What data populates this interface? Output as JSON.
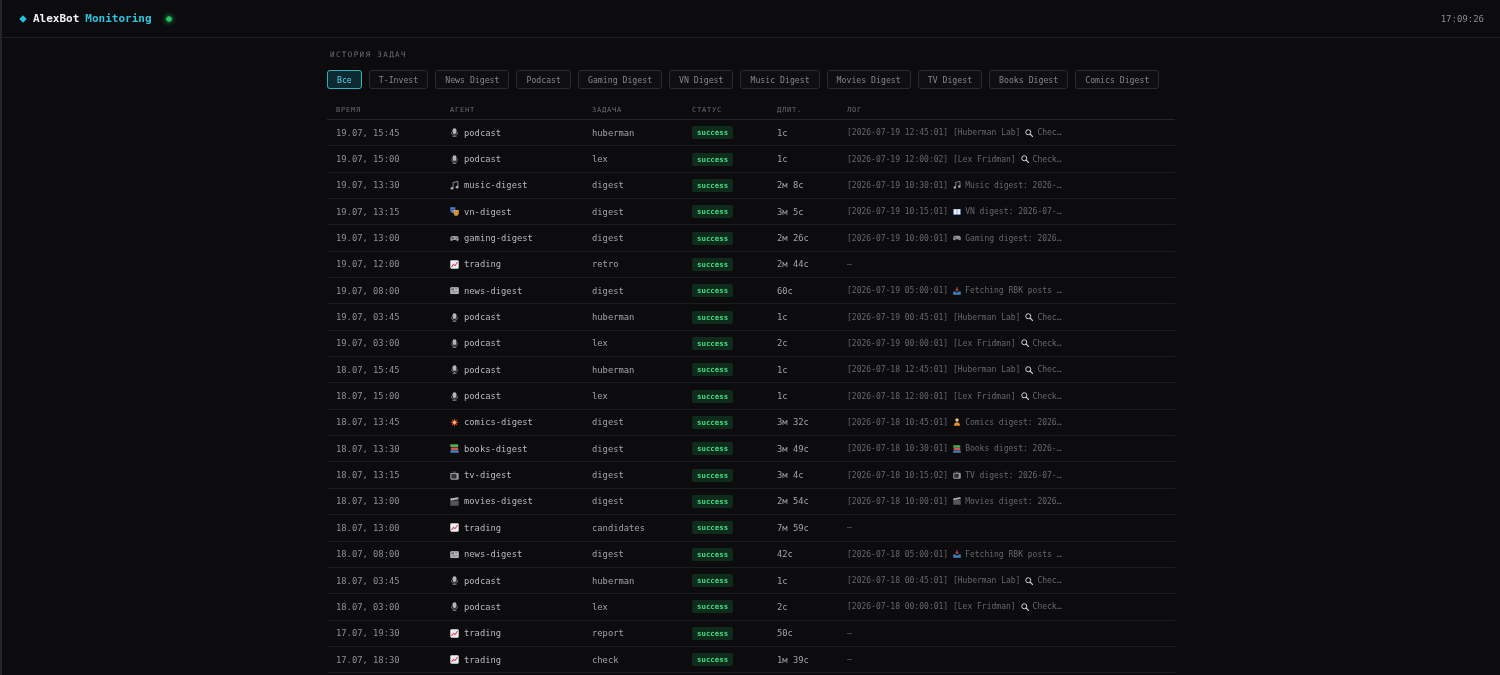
{
  "header": {
    "brand": "AlexBot",
    "brand_suffix": "Monitoring",
    "online": true,
    "clock": "17:09:26"
  },
  "history": {
    "title": "ИСТОРИЯ ЗАДАЧ",
    "filters": [
      {
        "label": "Все",
        "selected": true
      },
      {
        "label": "T-Invest",
        "selected": false
      },
      {
        "label": "News Digest",
        "selected": false
      },
      {
        "label": "Podcast",
        "selected": false
      },
      {
        "label": "Gaming Digest",
        "selected": false
      },
      {
        "label": "VN Digest",
        "selected": false
      },
      {
        "label": "Music Digest",
        "selected": false
      },
      {
        "label": "Movies Digest",
        "selected": false
      },
      {
        "label": "TV Digest",
        "selected": false
      },
      {
        "label": "Books Digest",
        "selected": false
      },
      {
        "label": "Comics Digest",
        "selected": false
      }
    ],
    "table": {
      "columns": [
        "ВРЕМЯ",
        "АГЕНТ",
        "ЗАДАЧА",
        "СТАТУС",
        "ДЛИТ.",
        "ЛОГ"
      ],
      "rows": [
        {
          "time": "19.07, 15:45",
          "agent": "podcast",
          "kind": "podcast",
          "task": "huberman",
          "status": "success",
          "duration": "1с",
          "log": {
            "head": "[2026-07-19 12:45:01] [Huberman Lab]",
            "tail": "Chec…"
          }
        },
        {
          "time": "19.07, 15:00",
          "agent": "podcast",
          "kind": "podcast",
          "task": "lex",
          "status": "success",
          "duration": "1с",
          "log": {
            "head": "[2026-07-19 12:00:02] [Lex Fridman]",
            "tail": "Check…"
          }
        },
        {
          "time": "19.07, 13:30",
          "agent": "music-digest",
          "kind": "music",
          "task": "digest",
          "status": "success",
          "duration": "2м 8с",
          "log": {
            "head": "[2026-07-19 10:30:01]",
            "tail": "Music digest: 2026-…"
          }
        },
        {
          "time": "19.07, 13:15",
          "agent": "vn-digest",
          "kind": "vn",
          "task": "digest",
          "status": "success",
          "duration": "3м 5с",
          "log": {
            "head": "[2026-07-19 10:15:01]",
            "tail": "VN digest: 2026-07-…"
          }
        },
        {
          "time": "19.07, 13:00",
          "agent": "gaming-digest",
          "kind": "gaming",
          "task": "digest",
          "status": "success",
          "duration": "2м 26с",
          "log": {
            "head": "[2026-07-19 10:00:01]",
            "tail": "Gaming digest: 2026…"
          }
        },
        {
          "time": "19.07, 12:00",
          "agent": "trading",
          "kind": "trading",
          "task": "retro",
          "status": "success",
          "duration": "2м 44с",
          "log": {
            "head": "—"
          }
        },
        {
          "time": "19.07, 08:00",
          "agent": "news-digest",
          "kind": "news",
          "task": "digest",
          "status": "success",
          "duration": "60с",
          "log": {
            "head": "[2026-07-19 05:00:01]",
            "tail": "Fetching RBK posts …"
          }
        },
        {
          "time": "19.07, 03:45",
          "agent": "podcast",
          "kind": "podcast",
          "task": "huberman",
          "status": "success",
          "duration": "1с",
          "log": {
            "head": "[2026-07-19 00:45:01] [Huberman Lab]",
            "tail": "Chec…"
          }
        },
        {
          "time": "19.07, 03:00",
          "agent": "podcast",
          "kind": "podcast",
          "task": "lex",
          "status": "success",
          "duration": "2с",
          "log": {
            "head": "[2026-07-19 00:00:01] [Lex Fridman]",
            "tail": "Check…"
          }
        },
        {
          "time": "18.07, 15:45",
          "agent": "podcast",
          "kind": "podcast",
          "task": "huberman",
          "status": "success",
          "duration": "1с",
          "log": {
            "head": "[2026-07-18 12:45:01] [Huberman Lab]",
            "tail": "Chec…"
          }
        },
        {
          "time": "18.07, 15:00",
          "agent": "podcast",
          "kind": "podcast",
          "task": "lex",
          "status": "success",
          "duration": "1с",
          "log": {
            "head": "[2026-07-18 12:00:01] [Lex Fridman]",
            "tail": "Check…"
          }
        },
        {
          "time": "18.07, 13:45",
          "agent": "comics-digest",
          "kind": "comics",
          "task": "digest",
          "status": "success",
          "duration": "3м 32с",
          "log": {
            "head": "[2026-07-18 10:45:01]",
            "tail": "Comics digest: 2026…"
          }
        },
        {
          "time": "18.07, 13:30",
          "agent": "books-digest",
          "kind": "books",
          "task": "digest",
          "status": "success",
          "duration": "3м 49с",
          "log": {
            "head": "[2026-07-18 10:30:01]",
            "tail": "Books digest: 2026-…"
          }
        },
        {
          "time": "18.07, 13:15",
          "agent": "tv-digest",
          "kind": "tv",
          "task": "digest",
          "status": "success",
          "duration": "3м 4с",
          "log": {
            "head": "[2026-07-18 10:15:02]",
            "tail": "TV digest: 2026-07-…"
          }
        },
        {
          "time": "18.07, 13:00",
          "agent": "movies-digest",
          "kind": "movies",
          "task": "digest",
          "status": "success",
          "duration": "2м 54с",
          "log": {
            "head": "[2026-07-18 10:00:01]",
            "tail": "Movies digest: 2026…"
          }
        },
        {
          "time": "18.07, 13:00",
          "agent": "trading",
          "kind": "trading",
          "task": "candidates",
          "status": "success",
          "duration": "7м 59с",
          "log": {
            "head": "—"
          }
        },
        {
          "time": "18.07, 08:00",
          "agent": "news-digest",
          "kind": "news",
          "task": "digest",
          "status": "success",
          "duration": "42с",
          "log": {
            "head": "[2026-07-18 05:00:01]",
            "tail": "Fetching RBK posts …"
          }
        },
        {
          "time": "18.07, 03:45",
          "agent": "podcast",
          "kind": "podcast",
          "task": "huberman",
          "status": "success",
          "duration": "1с",
          "log": {
            "head": "[2026-07-18 00:45:01] [Huberman Lab]",
            "tail": "Chec…"
          }
        },
        {
          "time": "18.07, 03:00",
          "agent": "podcast",
          "kind": "podcast",
          "task": "lex",
          "status": "success",
          "duration": "2с",
          "log": {
            "head": "[2026-07-18 00:00:01] [Lex Fridman]",
            "tail": "Check…"
          }
        },
        {
          "time": "17.07, 19:30",
          "agent": "trading",
          "kind": "trading",
          "task": "report",
          "status": "success",
          "duration": "50с",
          "log": {
            "head": "—"
          }
        },
        {
          "time": "17.07, 18:30",
          "agent": "trading",
          "kind": "trading",
          "task": "check",
          "status": "success",
          "duration": "1м 39с",
          "log": {
            "head": "—"
          }
        }
      ]
    }
  }
}
